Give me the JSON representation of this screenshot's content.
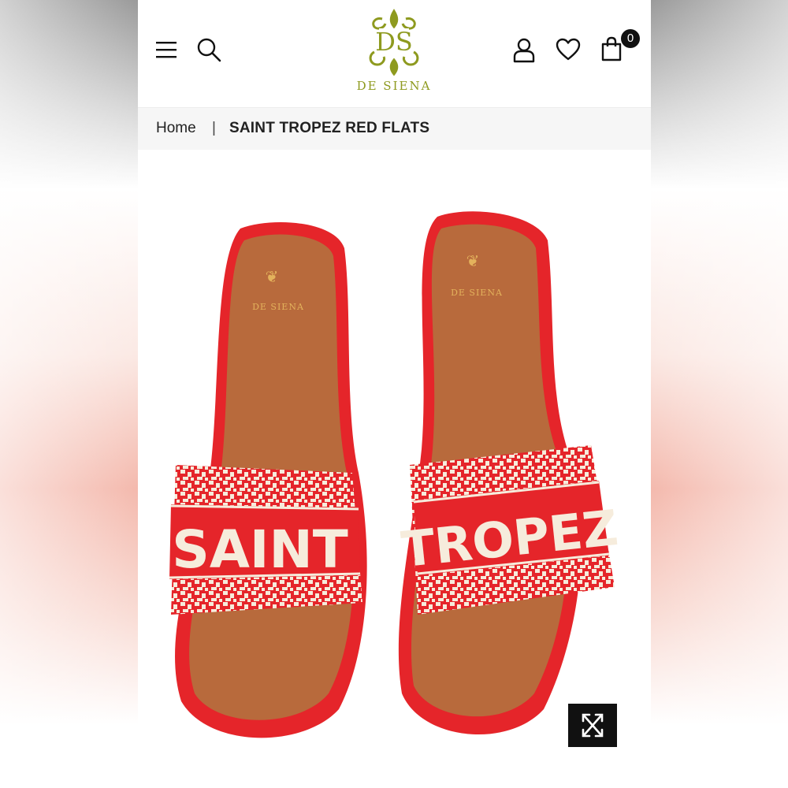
{
  "header": {
    "brand_name": "DE SIENA",
    "brand_monogram": "DS",
    "cart_count": "0",
    "icons": [
      "menu-icon",
      "search-icon",
      "user-icon",
      "heart-icon",
      "shopping-bag-icon"
    ]
  },
  "breadcrumb": {
    "home": "Home",
    "separator": "|",
    "current": "SAINT TROPEZ RED FLATS"
  },
  "product_image": {
    "insole_brand": "DE SIENA",
    "left_strap_text": "SAINT",
    "right_strap_text": "TROPEZ"
  },
  "colors": {
    "brand_olive": "#8e9a1f",
    "strap_red": "#e5252a",
    "insole_tan": "#b86a3c",
    "bead_cream": "#f6ecdc"
  }
}
